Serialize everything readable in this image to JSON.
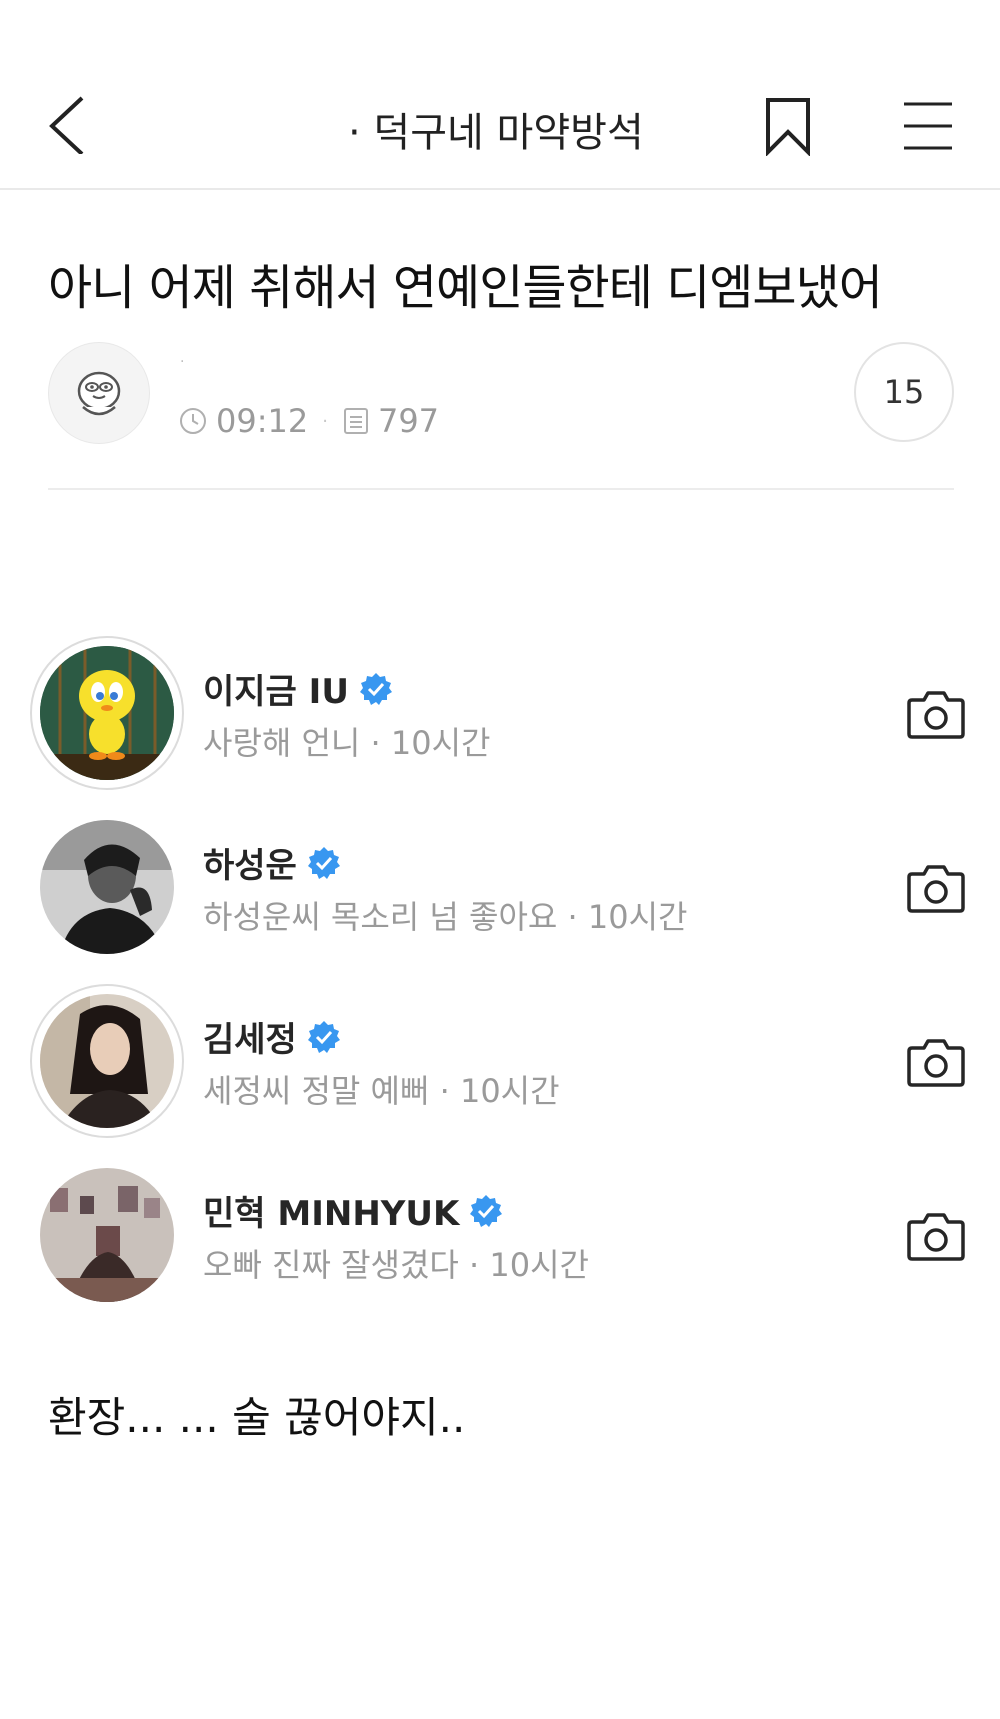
{
  "header": {
    "board_title": "· 덕구네 마약방석"
  },
  "post": {
    "title": "아니 어제 취해서 연예인들한테 디엠보냈어",
    "author_name": "·",
    "time": "09:12",
    "views": "797",
    "comment_count": "15",
    "body": "환장... ... 술 끊어야지.."
  },
  "dm_list": [
    {
      "name": "이지금 IU",
      "message": "사랑해 언니",
      "time": "10시간"
    },
    {
      "name": "하성운",
      "message": "하성운씨 목소리 넘 좋아요",
      "time": "10시간"
    },
    {
      "name": "김세정",
      "message": "세정씨 정말 예뻐",
      "time": "10시간"
    },
    {
      "name": "민혁 MINHYUK",
      "message": "오빠 진짜 잘생겼다",
      "time": "10시간"
    }
  ],
  "colors": {
    "verified_badge": "#3897f0",
    "meta_gray": "#9a9a9a"
  },
  "icons": [
    "back-arrow-icon",
    "bookmark-icon",
    "menu-icon",
    "clock-icon",
    "document-icon",
    "verified-badge-icon",
    "camera-icon"
  ]
}
